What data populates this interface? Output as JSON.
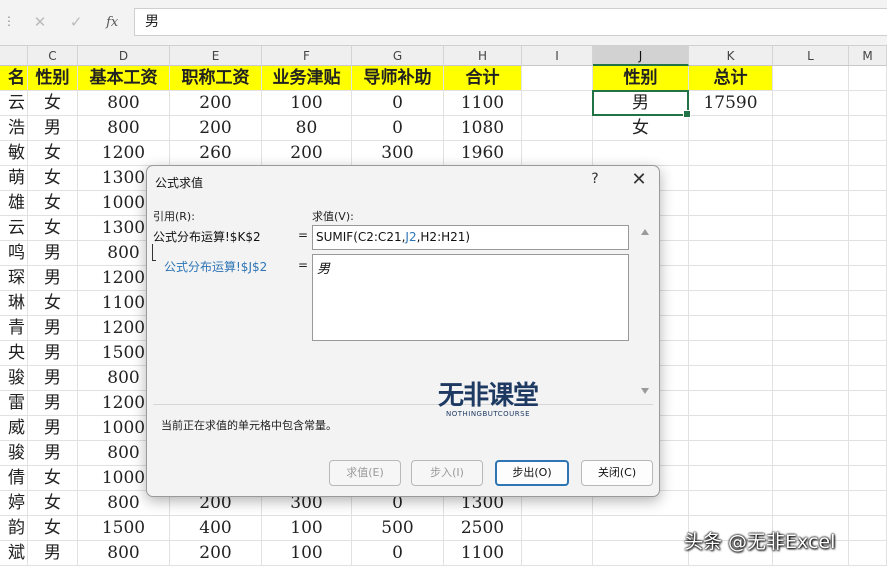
{
  "formula_bar": {
    "cancel_glyph": "✕",
    "enter_glyph": "✓",
    "fx_label": "fx",
    "value": "男"
  },
  "columns": [
    {
      "id": "c_b",
      "label": ""
    },
    {
      "id": "c_c",
      "label": "C"
    },
    {
      "id": "c_d",
      "label": "D"
    },
    {
      "id": "c_e",
      "label": "E"
    },
    {
      "id": "c_f",
      "label": "F"
    },
    {
      "id": "c_g",
      "label": "G"
    },
    {
      "id": "c_h",
      "label": "H"
    },
    {
      "id": "c_i",
      "label": "I"
    },
    {
      "id": "c_j",
      "label": "J"
    },
    {
      "id": "c_k",
      "label": "K"
    },
    {
      "id": "c_l",
      "label": "L"
    },
    {
      "id": "c_m",
      "label": "M"
    }
  ],
  "table": {
    "headers": [
      "名",
      "性别",
      "基本工资",
      "职称工资",
      "业务津贴",
      "导师补助",
      "合计"
    ],
    "rows": [
      [
        "云",
        "女",
        "800",
        "200",
        "100",
        "0",
        "1100"
      ],
      [
        "浩",
        "男",
        "800",
        "200",
        "80",
        "0",
        "1080"
      ],
      [
        "敏",
        "女",
        "1200",
        "260",
        "200",
        "300",
        "1960"
      ],
      [
        "萌",
        "女",
        "1300",
        "",
        "",
        "",
        ""
      ],
      [
        "雄",
        "女",
        "1000",
        "",
        "",
        "",
        ""
      ],
      [
        "云",
        "女",
        "1300",
        "",
        "",
        "",
        ""
      ],
      [
        "鸣",
        "男",
        "800",
        "",
        "",
        "",
        ""
      ],
      [
        "琛",
        "男",
        "1200",
        "",
        "",
        "",
        ""
      ],
      [
        "琳",
        "女",
        "1100",
        "",
        "",
        "",
        ""
      ],
      [
        "青",
        "男",
        "1200",
        "",
        "",
        "",
        ""
      ],
      [
        "央",
        "男",
        "1500",
        "",
        "",
        "",
        ""
      ],
      [
        "骏",
        "男",
        "800",
        "",
        "",
        "",
        ""
      ],
      [
        "雷",
        "男",
        "1200",
        "",
        "",
        "",
        ""
      ],
      [
        "威",
        "男",
        "1000",
        "",
        "",
        "",
        ""
      ],
      [
        "骏",
        "男",
        "800",
        "",
        "",
        "",
        ""
      ],
      [
        "倩",
        "女",
        "1000",
        "",
        "",
        "",
        ""
      ],
      [
        "婷",
        "女",
        "800",
        "200",
        "300",
        "0",
        "1300"
      ],
      [
        "韵",
        "女",
        "1500",
        "400",
        "100",
        "500",
        "2500"
      ],
      [
        "斌",
        "男",
        "800",
        "200",
        "100",
        "0",
        "1100"
      ]
    ]
  },
  "summary": {
    "headers": [
      "性别",
      "总计"
    ],
    "rows": [
      [
        "男",
        "17590"
      ],
      [
        "女",
        ""
      ]
    ]
  },
  "dialog": {
    "title": "公式求值",
    "help": "?",
    "close": "✕",
    "ref_label": "引用(R):",
    "value_label": "求值(V):",
    "ref_main": "公式分布运算!$K$2",
    "ref_sub": "公式分布运算!$J$2",
    "equals": "=",
    "formula_pre": "SUMIF(C2:C21,",
    "formula_hl": "J2",
    "formula_post": ",H2:H21)",
    "value": "男",
    "status": "当前正在求值的单元格中包含常量。",
    "buttons": {
      "evaluate": "求值(E)",
      "step_in": "步入(I)",
      "step_out": "步出(O)",
      "close": "关闭(C)"
    }
  },
  "watermark": {
    "main": "无非课堂",
    "sub": "NOTHINGBUTCOURSE"
  },
  "byline": "头条 @无非Excel",
  "colors": {
    "header_fill": "#ffff00",
    "accent_green": "#217346",
    "ref_blue": "#2e75b6",
    "arrow_red": "#e02020"
  }
}
